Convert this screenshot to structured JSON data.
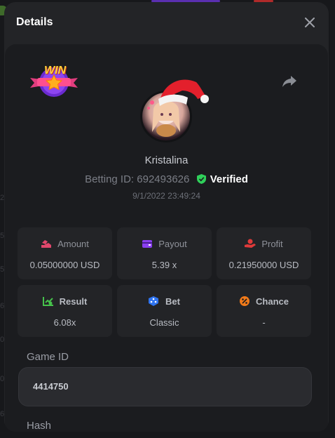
{
  "modal": {
    "title": "Details"
  },
  "badge": {
    "text": "WIN"
  },
  "player": {
    "name": "Kristalina",
    "betting_id_label": "Betting ID:",
    "betting_id": "692493626",
    "verified_label": "Verified",
    "timestamp": "9/1/2022 23:49:24"
  },
  "stats": [
    {
      "label": "Amount",
      "value": "0.05000000 USD",
      "icon": "coins-icon",
      "color": "#e0476c"
    },
    {
      "label": "Payout",
      "value": "5.39 x",
      "icon": "wallet-icon",
      "color": "#8a3ff0"
    },
    {
      "label": "Profit",
      "value": "0.21950000 USD",
      "icon": "hand-coin-icon",
      "color": "#e03a3a"
    },
    {
      "label": "Result",
      "value": "6.08x",
      "icon": "chart-check-icon",
      "color": "#46c24b"
    },
    {
      "label": "Bet",
      "value": "Classic",
      "icon": "dice-icon",
      "color": "#2f74f0"
    },
    {
      "label": "Chance",
      "value": "-",
      "icon": "percent-icon",
      "color": "#f07a1a"
    }
  ],
  "game_id": {
    "label": "Game ID",
    "value": "4414750"
  },
  "hash": {
    "label": "Hash"
  },
  "colors": {
    "verified": "#2fd05a",
    "accent_bg": "#1b1c1f"
  }
}
